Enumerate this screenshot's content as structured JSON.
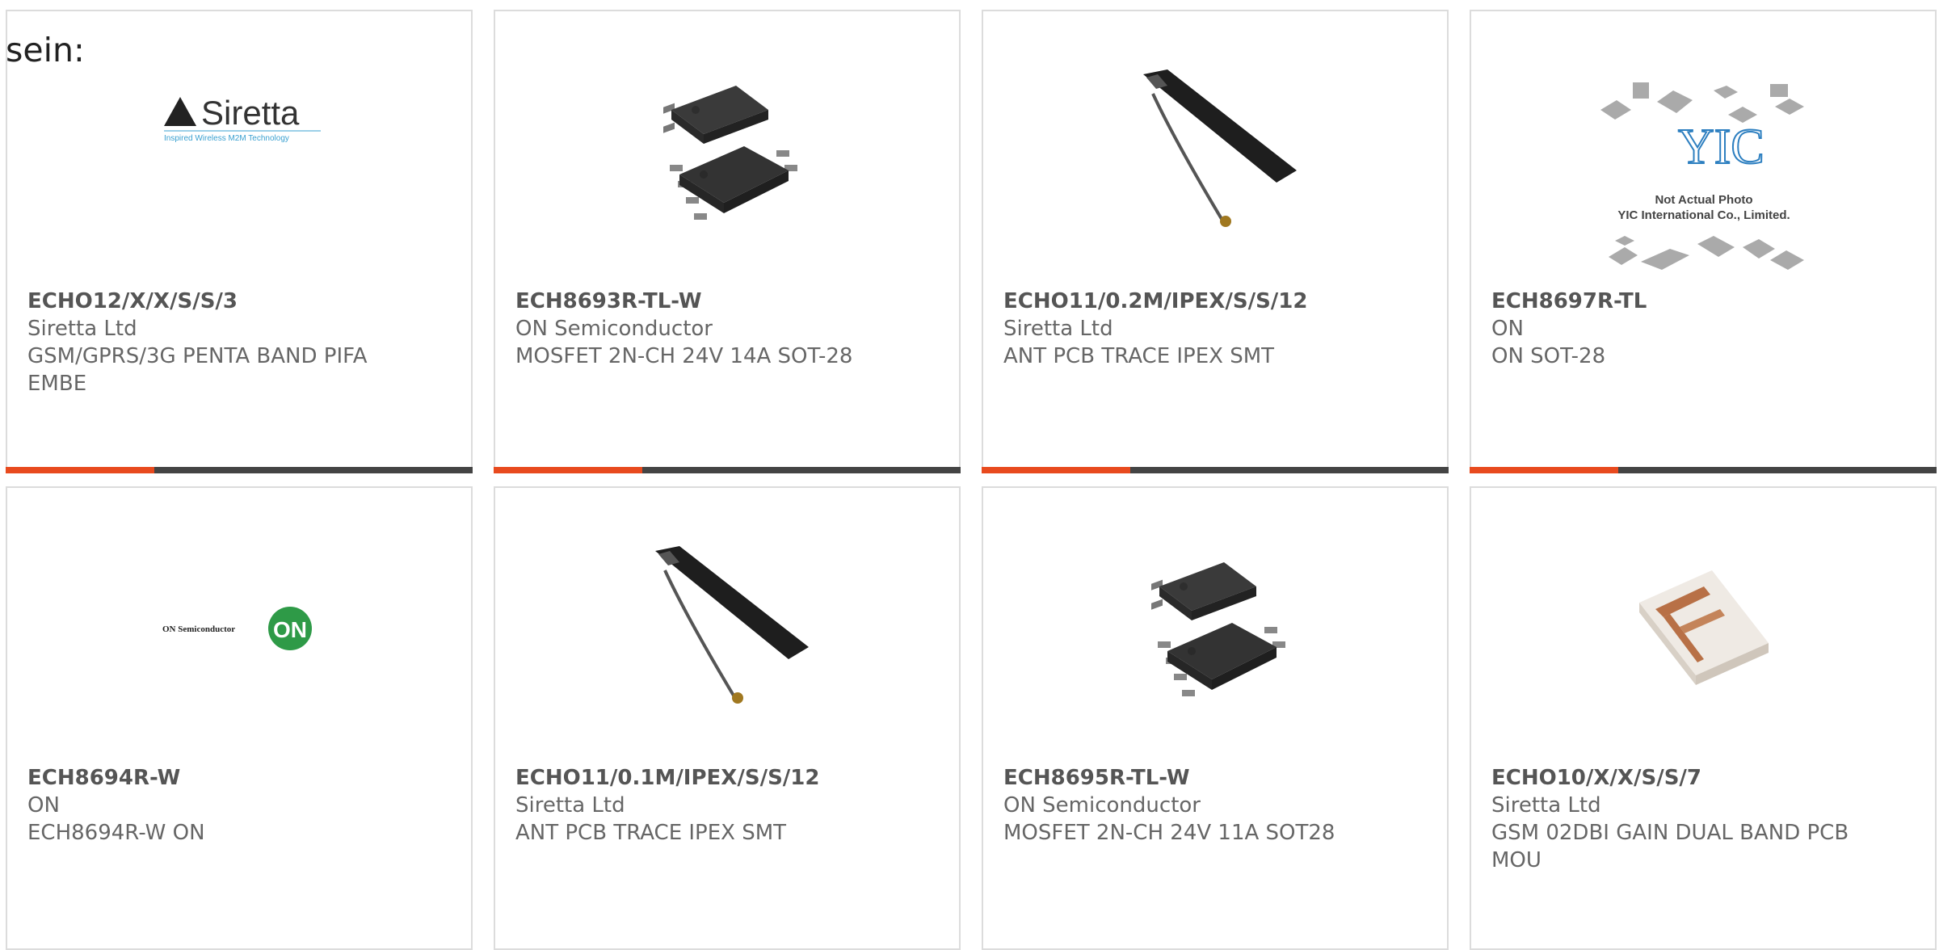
{
  "intro_text": "sein:",
  "colors": {
    "accent": "#e84a1e",
    "bar": "#444444",
    "border": "#dcdcdc",
    "text": "#666666"
  },
  "products": [
    {
      "part": "ECHO12/X/X/S/S/3",
      "manufacturer": "Siretta Ltd",
      "description": "GSM/GPRS/3G PENTA BAND PIFA EMBE",
      "image": "siretta-logo",
      "brand": "Siretta",
      "tagline": "Inspired Wireless M2M Technology"
    },
    {
      "part": "ECH8693R-TL-W",
      "manufacturer": "ON Semiconductor",
      "description": "MOSFET 2N-CH 24V 14A SOT-28",
      "image": "ic-chip"
    },
    {
      "part": "ECHO11/0.2M/IPEX/S/S/12",
      "manufacturer": "Siretta Ltd",
      "description": "ANT PCB TRACE IPEX SMT",
      "image": "pcb-antenna"
    },
    {
      "part": "ECH8697R-TL",
      "manufacturer": "ON",
      "description": "ON SOT-28",
      "image": "yic-placeholder",
      "brand": "YIC",
      "note1": "Not Actual Photo",
      "note2": "YIC International Co., Limited."
    },
    {
      "part": "ECH8694R-W",
      "manufacturer": "ON",
      "description": "ECH8694R-W ON",
      "image": "on-semi-logo",
      "brand": "ON Semiconductor",
      "mark": "ON"
    },
    {
      "part": "ECHO11/0.1M/IPEX/S/S/12",
      "manufacturer": "Siretta Ltd",
      "description": "ANT PCB TRACE IPEX SMT",
      "image": "pcb-antenna"
    },
    {
      "part": "ECH8695R-TL-W",
      "manufacturer": "ON Semiconductor",
      "description": "MOSFET 2N-CH 24V 11A SOT28",
      "image": "ic-chip"
    },
    {
      "part": "ECHO10/X/X/S/S/7",
      "manufacturer": "Siretta Ltd",
      "description": "GSM 02DBI GAIN DUAL BAND PCB MOU",
      "image": "ceramic-antenna"
    }
  ]
}
